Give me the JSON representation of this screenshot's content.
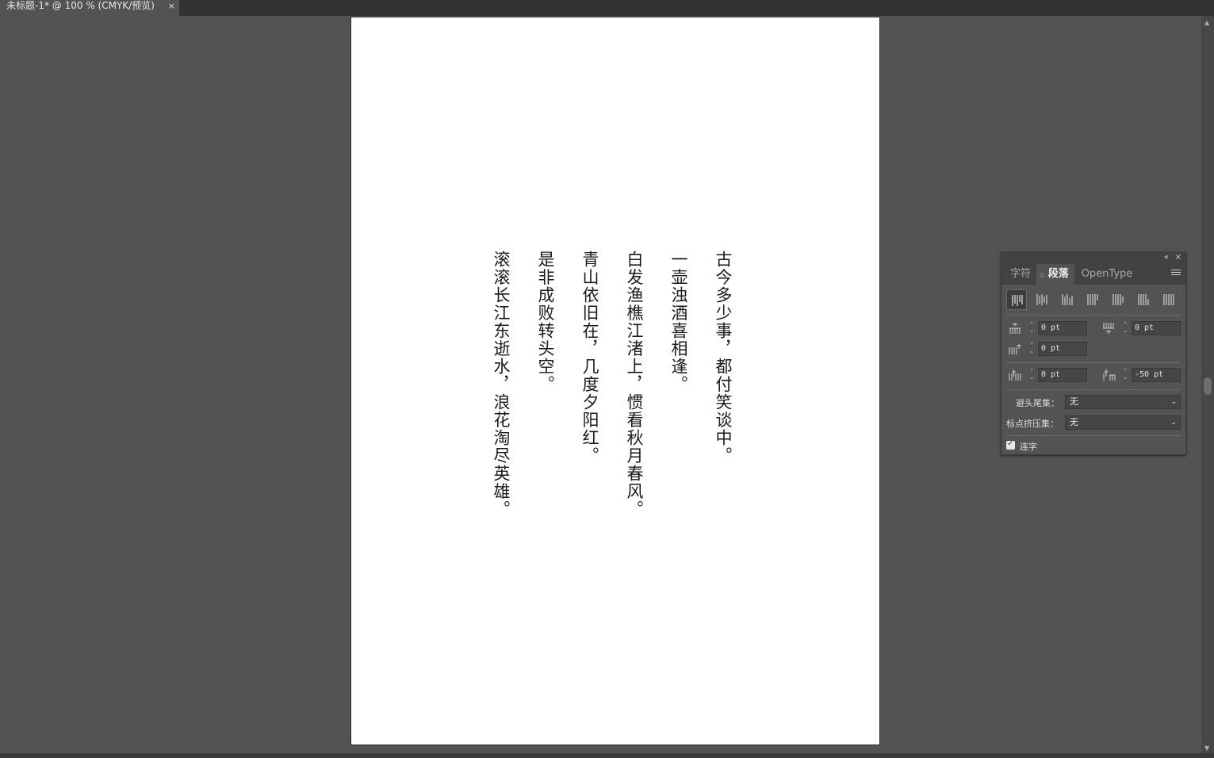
{
  "document_tab": {
    "title": "未标题-1* @ 100 % (CMYK/预览)",
    "close_glyph": "×"
  },
  "poem": {
    "lines": [
      "古今多少事，都付笑谈中。",
      "一壶浊酒喜相逢。",
      "白发渔樵江渚上，惯看秋月春风。",
      "青山依旧在，几度夕阳红。",
      "是非成败转头空。",
      "滚滚长江东逝水，浪花淘尽英雄。"
    ]
  },
  "panel": {
    "collapse_glyph": "«",
    "close_glyph": "×",
    "tabs": [
      "字符",
      "段落",
      "OpenType"
    ],
    "active_tab": "段落",
    "tab_sort_glyph": "◇",
    "alignment_buttons": [
      "align-top-icon",
      "align-center-icon",
      "align-bottom-icon",
      "justify-last-top-icon",
      "justify-last-center-icon",
      "justify-last-bottom-icon",
      "justify-all-icon"
    ],
    "indents": {
      "left_indent": "0 pt",
      "right_indent": "0 pt",
      "first_line_indent": "0 pt",
      "space_before": "0 pt",
      "space_after": "-50 pt"
    },
    "kinsoku_label": "避头尾集：",
    "kinsoku_value": "无",
    "mojikumi_label": "标点挤压集：",
    "mojikumi_value": "无",
    "hyphenate_label": "连字",
    "hyphenate_checked": true
  },
  "colors": {
    "workspace": "#535353",
    "artboard": "#ffffff",
    "panel": "#535353"
  }
}
